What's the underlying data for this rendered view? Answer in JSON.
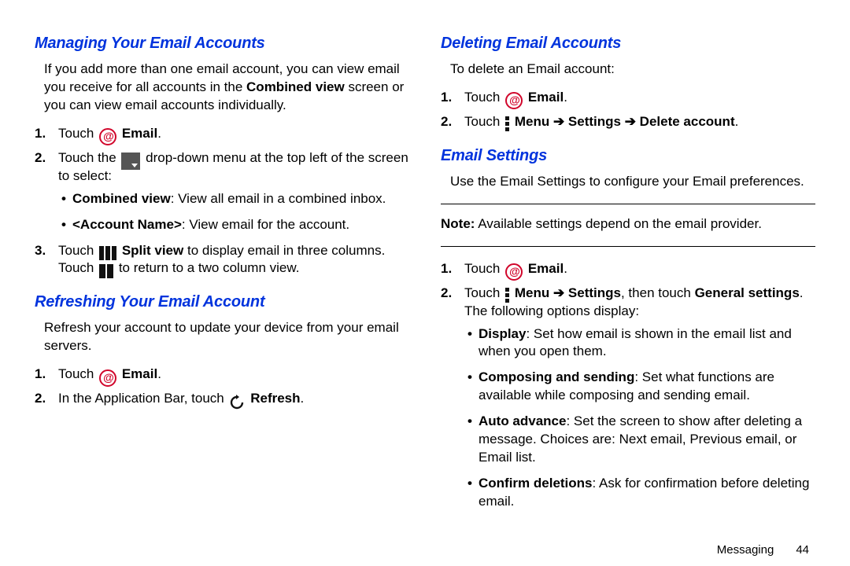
{
  "left": {
    "h1": "Managing Your Email Accounts",
    "p1a": "If you add more than one email account, you can view email you receive for all accounts in the ",
    "p1b": "Combined view",
    "p1c": " screen or you can view email accounts individually.",
    "s1_num": "1.",
    "s1a": "Touch ",
    "s1b": "Email",
    "s1c": ".",
    "s2_num": "2.",
    "s2a": "Touch the ",
    "s2b": " drop-down menu at the top left of the screen to select:",
    "b1a": "Combined view",
    "b1b": ": View all email in a combined inbox.",
    "b2a": "<Account Name>",
    "b2b": ": View email for the account.",
    "s3_num": "3.",
    "s3a": "Touch ",
    "s3b": "Split view",
    "s3c": " to display email in three columns. Touch ",
    "s3d": " to return to a two column view.",
    "h2": "Refreshing Your Email Account",
    "p2": "Refresh your account to update your device from your email servers.",
    "r1_num": "1.",
    "r1a": "Touch ",
    "r1b": "Email",
    "r1c": ".",
    "r2_num": "2.",
    "r2a": "In the Application Bar, touch ",
    "r2b": "Refresh",
    "r2c": "."
  },
  "right": {
    "h1": "Deleting Email Accounts",
    "p1": "To delete an Email account:",
    "d1_num": "1.",
    "d1a": "Touch ",
    "d1b": "Email",
    "d1c": ".",
    "d2_num": "2.",
    "d2a": "Touch ",
    "d2b": "Menu ",
    "d2arr1": "➔",
    "d2c": " Settings ",
    "d2arr2": "➔",
    "d2d": " Delete account",
    "d2e": ".",
    "h2": "Email Settings",
    "p2": "Use the Email Settings to configure your Email preferences.",
    "note_a": "Note:",
    "note_b": " Available settings depend on the email provider.",
    "e1_num": "1.",
    "e1a": "Touch ",
    "e1b": "Email",
    "e1c": ".",
    "e2_num": "2.",
    "e2a": "Touch ",
    "e2b": "Menu ",
    "e2arr": "➔",
    "e2c": " Settings",
    "e2d": ", then touch ",
    "e2e": "General settings",
    "e2f": ". The following options display:",
    "opt1a": "Display",
    "opt1b": ": Set how email is shown in the email list and when you open them.",
    "opt2a": "Composing and sending",
    "opt2b": ": Set what functions are available while composing and sending email.",
    "opt3a": "Auto advance",
    "opt3b": ": Set the screen to show after deleting a message. Choices are: Next email, Previous email, or Email list.",
    "opt4a": "Confirm deletions",
    "opt4b": ": Ask for confirmation before deleting email."
  },
  "footer": {
    "section": "Messaging",
    "page": "44"
  }
}
